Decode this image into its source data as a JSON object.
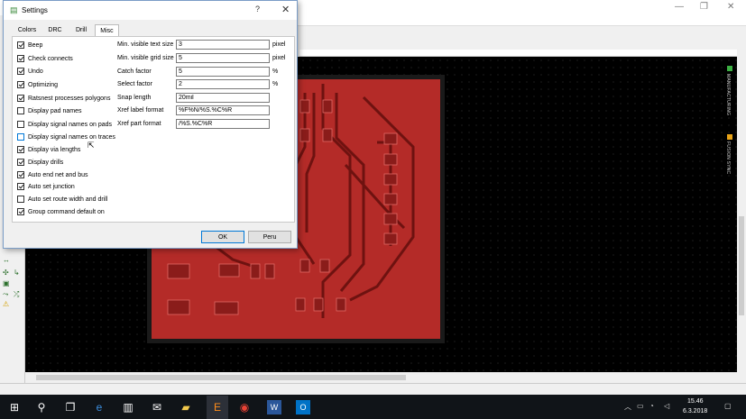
{
  "dialog": {
    "title": "Settings",
    "help_glyph": "?",
    "close_glyph": "✕",
    "tabs": [
      {
        "label": "Colors"
      },
      {
        "label": "DRC"
      },
      {
        "label": "Drill"
      },
      {
        "label": "Misc"
      }
    ],
    "active_tab": "Misc",
    "checkboxes": [
      {
        "label": "Beep",
        "checked": true
      },
      {
        "label": "Check connects",
        "checked": true
      },
      {
        "label": "Undo",
        "checked": true
      },
      {
        "label": "Optimizing",
        "checked": true
      },
      {
        "label": "Ratsnest processes polygons",
        "checked": true
      },
      {
        "label": "Display pad names",
        "checked": false
      },
      {
        "label": "Display signal names on pads",
        "checked": false
      },
      {
        "label": "Display signal names on traces",
        "checked": false
      },
      {
        "label": "Display via lengths",
        "checked": true
      },
      {
        "label": "Display drills",
        "checked": true
      },
      {
        "label": "Auto end net and bus",
        "checked": true
      },
      {
        "label": "Auto set junction",
        "checked": true
      },
      {
        "label": "Auto set route width and drill",
        "checked": false
      },
      {
        "label": "Group command default on",
        "checked": true
      }
    ],
    "fields": [
      {
        "label": "Min. visible text size",
        "value": "3",
        "unit": "pixel"
      },
      {
        "label": "Min. visible grid size",
        "value": "5",
        "unit": "pixel"
      },
      {
        "label": "Catch factor",
        "value": "5",
        "unit": "%"
      },
      {
        "label": "Select factor",
        "value": "2",
        "unit": "%"
      },
      {
        "label": "Snap length",
        "value": "20mil",
        "unit": ""
      },
      {
        "label": "Xref label format",
        "value": "%F%N/%S.%C%R",
        "unit": ""
      },
      {
        "label": "Xref part format",
        "value": "/%S.%C%R",
        "unit": ""
      }
    ],
    "ok_label": "OK",
    "cancel_label": "Peru"
  },
  "app": {
    "side_tabs": [
      "MANUFACTURING",
      "FUSION SYNC"
    ]
  },
  "taskbar": {
    "time": "15.46",
    "date": "6.3.2018"
  },
  "colors": {
    "board_fill": "#b42b28",
    "board_dark": "#6e1210",
    "board_edge": "#1a1a1a",
    "accent": "#0078d7"
  }
}
